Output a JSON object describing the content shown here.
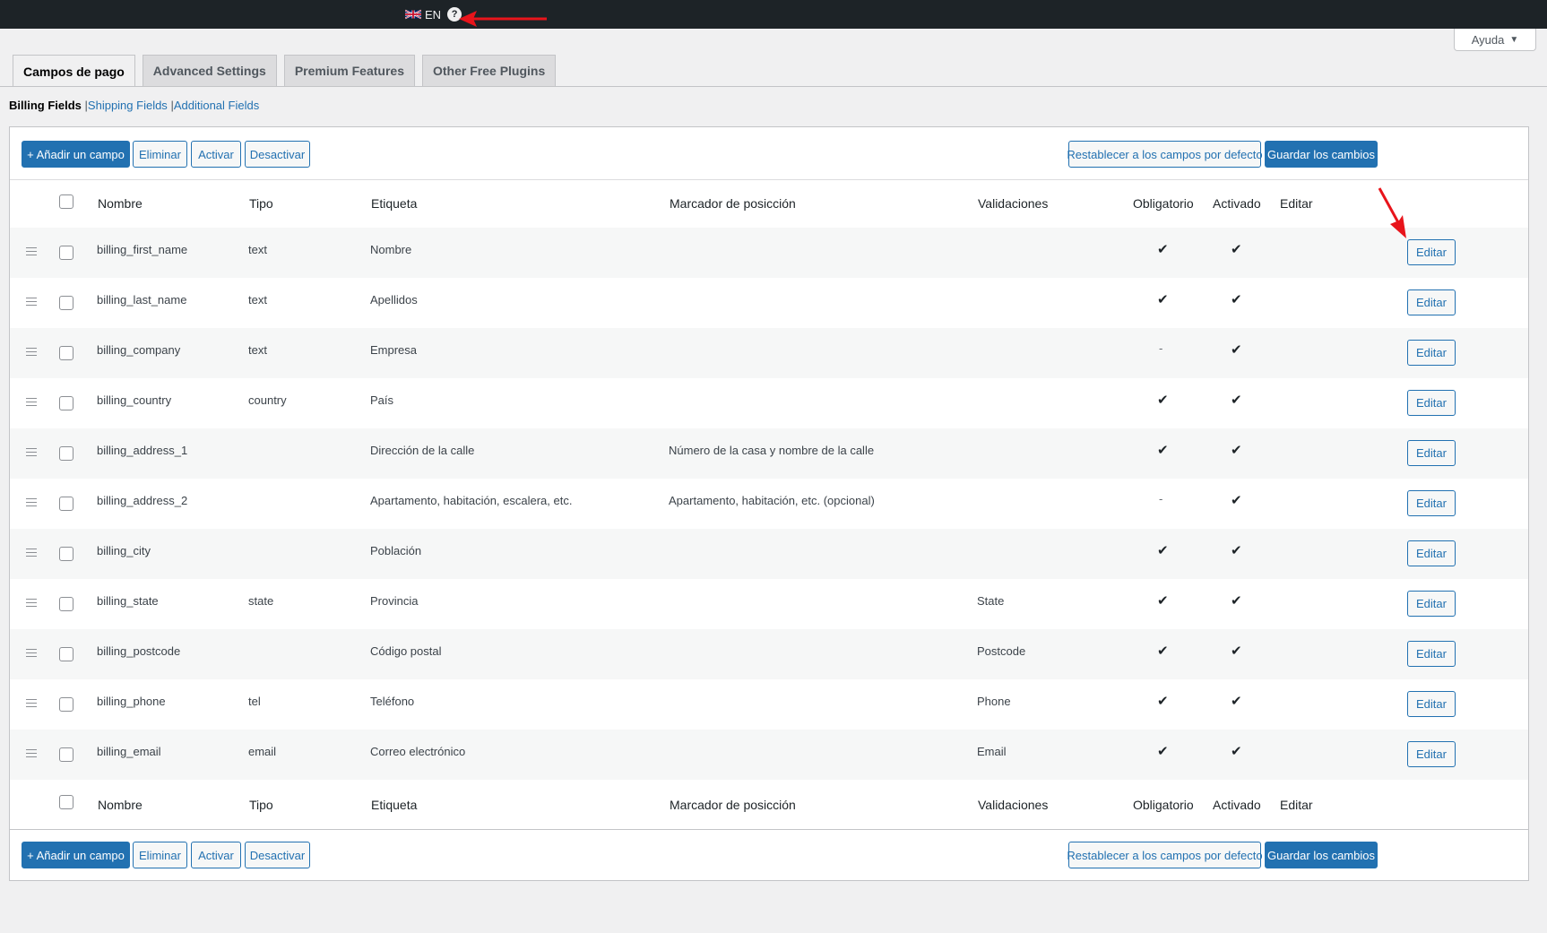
{
  "adminbar": {
    "language_code": "EN",
    "help_symbol": "?"
  },
  "help_tab": {
    "label": "Ayuda",
    "caret": "▼"
  },
  "tabs": [
    {
      "label": "Campos de pago",
      "active": true
    },
    {
      "label": "Advanced Settings",
      "active": false
    },
    {
      "label": "Premium Features",
      "active": false
    },
    {
      "label": "Other Free Plugins",
      "active": false
    }
  ],
  "subnav": {
    "current": "Billing Fields",
    "links": [
      "Shipping Fields",
      "Additional Fields"
    ],
    "separator": "|"
  },
  "actions": {
    "add": "+ Añadir un campo",
    "remove": "Eliminar",
    "enable": "Activar",
    "disable": "Desactivar",
    "reset": "Restablecer a los campos por defecto",
    "save": "Guardar los cambios"
  },
  "columns": {
    "name": "Nombre",
    "type": "Tipo",
    "label": "Etiqueta",
    "placeholder": "Marcador de posicción",
    "validations": "Validaciones",
    "required": "Obligatorio",
    "enabled": "Activado",
    "edit": "Editar"
  },
  "marks": {
    "check": "✔",
    "dash": "-"
  },
  "edit_label": "Editar",
  "rows": [
    {
      "name": "billing_first_name",
      "type": "text",
      "label": "Nombre",
      "placeholder": "",
      "validations": "",
      "required": true,
      "enabled": true
    },
    {
      "name": "billing_last_name",
      "type": "text",
      "label": "Apellidos",
      "placeholder": "",
      "validations": "",
      "required": true,
      "enabled": true
    },
    {
      "name": "billing_company",
      "type": "text",
      "label": "Empresa",
      "placeholder": "",
      "validations": "",
      "required": false,
      "enabled": true
    },
    {
      "name": "billing_country",
      "type": "country",
      "label": "País",
      "placeholder": "",
      "validations": "",
      "required": true,
      "enabled": true
    },
    {
      "name": "billing_address_1",
      "type": "",
      "label": "Dirección de la calle",
      "placeholder": "Número de la casa y nombre de la calle",
      "validations": "",
      "required": true,
      "enabled": true
    },
    {
      "name": "billing_address_2",
      "type": "",
      "label": "Apartamento, habitación, escalera, etc.",
      "placeholder": "Apartamento, habitación, etc. (opcional)",
      "validations": "",
      "required": false,
      "enabled": true
    },
    {
      "name": "billing_city",
      "type": "",
      "label": "Población",
      "placeholder": "",
      "validations": "",
      "required": true,
      "enabled": true
    },
    {
      "name": "billing_state",
      "type": "state",
      "label": "Provincia",
      "placeholder": "",
      "validations": "State",
      "required": true,
      "enabled": true
    },
    {
      "name": "billing_postcode",
      "type": "",
      "label": "Código postal",
      "placeholder": "",
      "validations": "Postcode",
      "required": true,
      "enabled": true
    },
    {
      "name": "billing_phone",
      "type": "tel",
      "label": "Teléfono",
      "placeholder": "",
      "validations": "Phone",
      "required": true,
      "enabled": true
    },
    {
      "name": "billing_email",
      "type": "email",
      "label": "Correo electrónico",
      "placeholder": "",
      "validations": "Email",
      "required": true,
      "enabled": true
    }
  ],
  "colors": {
    "primary": "#2271b1",
    "adminbar": "#1d2327",
    "annotation": "#e8141b"
  }
}
